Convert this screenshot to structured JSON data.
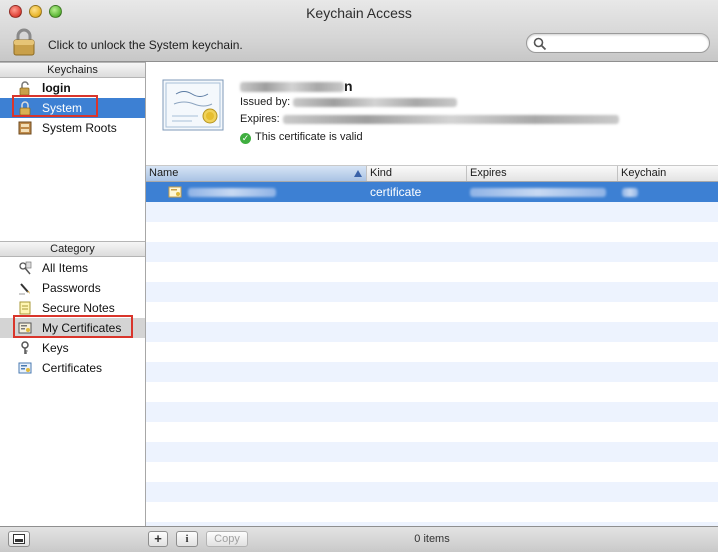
{
  "window": {
    "title": "Keychain Access"
  },
  "toolbar": {
    "unlock_text": "Click to unlock the System keychain."
  },
  "keychains": {
    "header": "Keychains",
    "items": [
      {
        "label": "login",
        "icon": "lock-open-icon"
      },
      {
        "label": "System",
        "icon": "lock-icon"
      },
      {
        "label": "System Roots",
        "icon": "cabinet-icon"
      }
    ]
  },
  "category": {
    "header": "Category",
    "items": [
      {
        "label": "All Items",
        "icon": "all-items-icon"
      },
      {
        "label": "Passwords",
        "icon": "pen-icon"
      },
      {
        "label": "Secure Notes",
        "icon": "note-icon"
      },
      {
        "label": "My Certificates",
        "icon": "my-certificate-icon"
      },
      {
        "label": "Keys",
        "icon": "key-icon"
      },
      {
        "label": "Certificates",
        "icon": "certificate-icon"
      }
    ]
  },
  "detail": {
    "name_suffix": "n",
    "issued_by_label": "Issued by:",
    "expires_label": "Expires:",
    "status": "This certificate is valid"
  },
  "table": {
    "columns": [
      "Name",
      "Kind",
      "Expires",
      "Keychain"
    ],
    "rows": [
      {
        "kind": "certificate"
      }
    ]
  },
  "bottom": {
    "add_label": "+",
    "info_label": "i",
    "copy_label": "Copy",
    "count": "0 items"
  }
}
